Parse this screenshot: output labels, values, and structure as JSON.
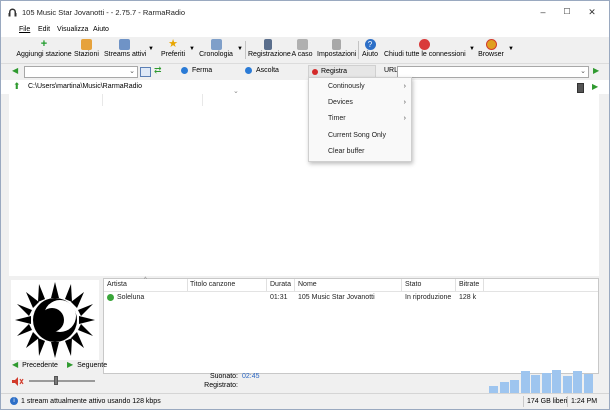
{
  "window": {
    "title": "105 Music Star Jovanotti  -  - 2.75.7 - RarmaRadio",
    "controls": [
      "–",
      "☐",
      "✕"
    ]
  },
  "menu": [
    {
      "label": "File"
    },
    {
      "label": "Edit"
    },
    {
      "label": "Visualizza"
    },
    {
      "label": "Aiuto"
    }
  ],
  "toolbar": {
    "add_station": "Aggiungi stazione",
    "stations": "Stazioni",
    "active_streams": "Streams attivi",
    "favorites": "Preferiti",
    "history": "Cronologia",
    "recording": "Registrazione",
    "random": "A caso",
    "settings": "Impostazioni",
    "help": "Aiuto",
    "close_all": "Chiudi tutte le connessioni",
    "browser": "Browser"
  },
  "controls": {
    "stop": "Ferma",
    "listen": "Ascolta",
    "record": "Registra",
    "url_label": "URL"
  },
  "path": "C:\\Users\\martina\\Music\\RarmaRadio",
  "record_menu": [
    {
      "label": "Continously",
      "submenu": true
    },
    {
      "label": "Devices",
      "submenu": true
    },
    {
      "label": "Timer",
      "submenu": true
    },
    {
      "label": "Current Song Only",
      "submenu": false
    },
    {
      "label": "Clear buffer",
      "submenu": false
    }
  ],
  "table": {
    "headers": [
      "Artista",
      "Titolo canzone",
      "Durata",
      "Nome",
      "Stato",
      "Bitrate"
    ],
    "rows": [
      {
        "artist": "Soleluna",
        "title": "",
        "duration": "01:31",
        "name": "105 Music Star Jovanotti",
        "status": "In riproduzione",
        "bitrate": "128 k"
      }
    ]
  },
  "nav": {
    "prev": "Precedente",
    "next": "Seguente"
  },
  "playback": {
    "played_label": "Suonato:",
    "played_value": "02:45",
    "recorded_label": "Registrato:",
    "volume_level": 0.4
  },
  "status": {
    "streams": "1 stream attualmente attivo usando 128 kbps",
    "disk": "174 GB liberi",
    "time": "1:24 PM"
  },
  "spectrum": {
    "levels": [
      0.3,
      0.45,
      0.55,
      0.9,
      0.75,
      0.85,
      0.95,
      0.7,
      0.9,
      0.8
    ]
  },
  "colors": {
    "accent": "#0078d7",
    "window_bg": "#f0f0f0",
    "spectrum": "#9ec5ef"
  }
}
